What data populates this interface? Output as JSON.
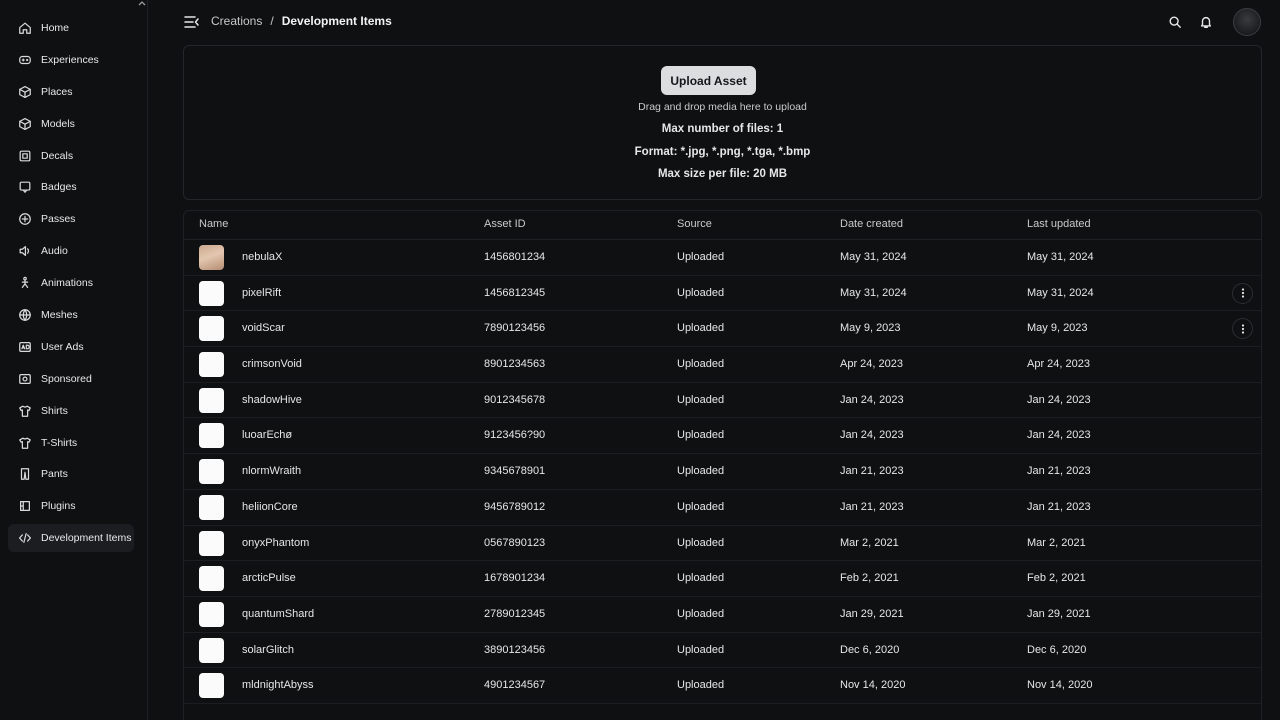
{
  "sidebar": {
    "items": [
      {
        "label": "Home",
        "icon": "home-icon"
      },
      {
        "label": "Experiences",
        "icon": "experiences-icon"
      },
      {
        "label": "Places",
        "icon": "cube-icon"
      },
      {
        "label": "Models",
        "icon": "cube-icon"
      },
      {
        "label": "Decals",
        "icon": "decal-icon"
      },
      {
        "label": "Badges",
        "icon": "badge-icon"
      },
      {
        "label": "Passes",
        "icon": "pass-icon"
      },
      {
        "label": "Audio",
        "icon": "audio-icon"
      },
      {
        "label": "Animations",
        "icon": "animation-icon"
      },
      {
        "label": "Meshes",
        "icon": "mesh-icon"
      },
      {
        "label": "User Ads",
        "icon": "user-ads-icon"
      },
      {
        "label": "Sponsored",
        "icon": "sponsored-icon"
      },
      {
        "label": "Shirts",
        "icon": "shirt-icon"
      },
      {
        "label": "T-Shirts",
        "icon": "tshirt-icon"
      },
      {
        "label": "Pants",
        "icon": "pants-icon"
      },
      {
        "label": "Plugins",
        "icon": "plugin-icon"
      },
      {
        "label": "Development Items",
        "icon": "code-icon",
        "active": true
      }
    ]
  },
  "header": {
    "breadcrumb": {
      "parent": "Creations",
      "separator": "/",
      "current": "Development Items"
    }
  },
  "upload": {
    "button_label": "Upload Asset",
    "drag_text": "Drag and drop media here to upload",
    "max_files": "Max number of files: 1",
    "format": "Format: *.jpg, *.png, *.tga, *.bmp",
    "max_size": "Max size per file: 20 MB"
  },
  "table": {
    "columns": [
      "Name",
      "Asset ID",
      "Source",
      "Date created",
      "Last updated"
    ],
    "rows": [
      {
        "name": "nebulaX",
        "asset_id": "1456801234",
        "source": "Uploaded",
        "created": "May 31, 2024",
        "updated": "May 31, 2024",
        "thumb": "image",
        "menu": false
      },
      {
        "name": "pixelRift",
        "asset_id": "1456812345",
        "source": "Uploaded",
        "created": "May 31, 2024",
        "updated": "May 31, 2024",
        "thumb": "blank",
        "menu": true
      },
      {
        "name": "voidScar",
        "asset_id": "7890123456",
        "source": "Uploaded",
        "created": "May 9, 2023",
        "updated": "May 9, 2023",
        "thumb": "blank",
        "menu": true
      },
      {
        "name": "crimsonVoid",
        "asset_id": "8901234563",
        "source": "Uploaded",
        "created": "Apr 24, 2023",
        "updated": "Apr 24, 2023",
        "thumb": "blank",
        "menu": false
      },
      {
        "name": "shadowHive",
        "asset_id": "9012345678",
        "source": "Uploaded",
        "created": "Jan 24, 2023",
        "updated": "Jan 24, 2023",
        "thumb": "blank",
        "menu": false
      },
      {
        "name": "luoarEchø",
        "asset_id": "9123456?90",
        "source": "Uploaded",
        "created": "Jan 24, 2023",
        "updated": "Jan 24, 2023",
        "thumb": "blank",
        "menu": false
      },
      {
        "name": "nlormWraith",
        "asset_id": "9345678901",
        "source": "Uploaded",
        "created": "Jan 21, 2023",
        "updated": "Jan 21, 2023",
        "thumb": "blank",
        "menu": false
      },
      {
        "name": "heliionCore",
        "asset_id": "9456789012",
        "source": "Uploaded",
        "created": "Jan 21, 2023",
        "updated": "Jan 21, 2023",
        "thumb": "blank",
        "menu": false
      },
      {
        "name": "onyxPhantom",
        "asset_id": "0567890123",
        "source": "Uploaded",
        "created": "Mar 2, 2021",
        "updated": "Mar 2, 2021",
        "thumb": "blank",
        "menu": false
      },
      {
        "name": "arcticPulse",
        "asset_id": "1678901234",
        "source": "Uploaded",
        "created": "Feb 2, 2021",
        "updated": "Feb 2, 2021",
        "thumb": "blank",
        "menu": false
      },
      {
        "name": "quantumShard",
        "asset_id": "2789012345",
        "source": "Uploaded",
        "created": "Jan 29, 2021",
        "updated": "Jan 29, 2021",
        "thumb": "blank",
        "menu": false
      },
      {
        "name": "solarGlitch",
        "asset_id": "3890123456",
        "source": "Uploaded",
        "created": "Dec 6, 2020",
        "updated": "Dec 6, 2020",
        "thumb": "blank",
        "menu": false
      },
      {
        "name": "mldnightAbyss",
        "asset_id": "4901234567",
        "source": "Uploaded",
        "created": "Nov 14, 2020",
        "updated": "Nov 14, 2020",
        "thumb": "blank",
        "menu": false
      }
    ]
  },
  "colors": {
    "background": "#0f1012",
    "text": "#e6e7e8",
    "button": "#dcdddf",
    "active_nav": "#1c1d20"
  }
}
